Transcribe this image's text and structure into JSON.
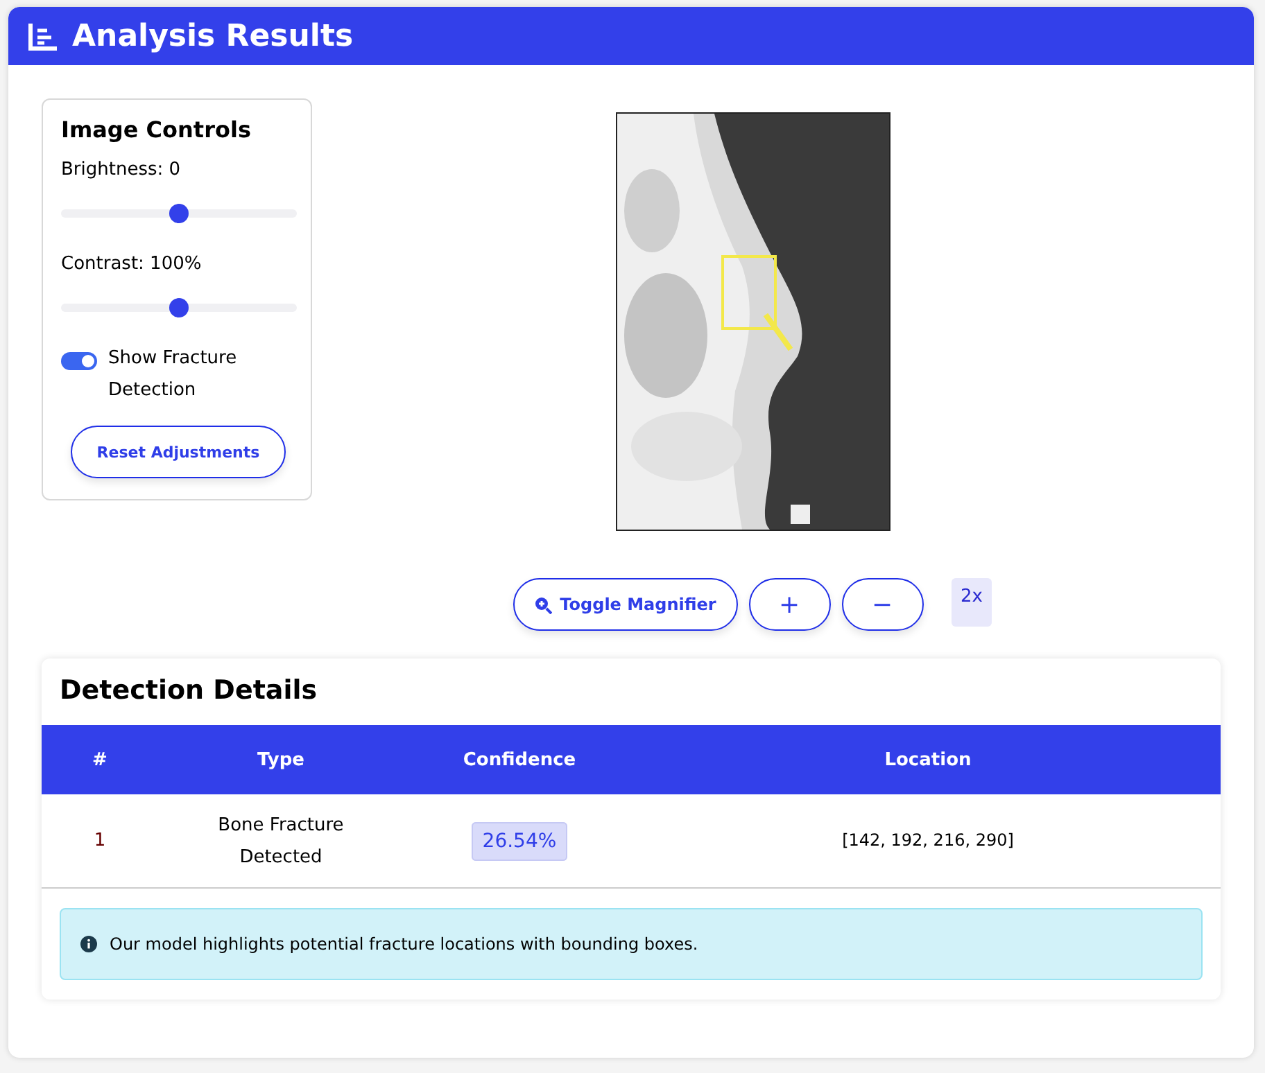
{
  "header": {
    "title": "Analysis Results"
  },
  "controls": {
    "title": "Image Controls",
    "sliders": [
      {
        "label": "Brightness: 0",
        "level": 0.5
      },
      {
        "label": "Contrast: 100%",
        "level": 0.5
      }
    ],
    "toggle": {
      "label": "Show Fracture Detection",
      "on": true
    },
    "reset_button": "Reset Adjustments"
  },
  "viewer": {
    "magnifier_button": "Toggle Magnifier",
    "zoom_in": "+",
    "zoom_out": "−",
    "zoom_level": "2x"
  },
  "details": {
    "title": "Detection Details",
    "columns": [
      "#",
      "Type",
      "Confidence",
      "Location"
    ],
    "rows": [
      {
        "index": "1",
        "type": "Bone Fracture Detected",
        "confidence": "26.54%",
        "location": "[142, 192, 216, 290]"
      }
    ],
    "note": "Our model highlights potential fracture locations with bounding boxes."
  }
}
